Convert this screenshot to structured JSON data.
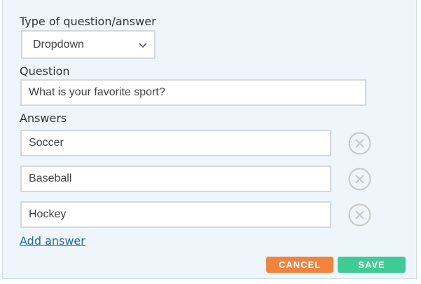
{
  "type_label": "Type of question/answer",
  "type_select": {
    "value": "Dropdown",
    "icon": "chevron-down-icon"
  },
  "question_label": "Question",
  "question_input": {
    "value": "What is your favorite sport?"
  },
  "answers_label": "Answers",
  "answers": [
    {
      "value": "Soccer"
    },
    {
      "value": "Baseball"
    },
    {
      "value": "Hockey"
    }
  ],
  "remove_icon": "close-circle-icon",
  "add_answer_label": "Add answer",
  "buttons": {
    "cancel_label": "CANCEL",
    "save_label": "SAVE"
  },
  "colors": {
    "panel_bg": "#eef6fc",
    "cancel": "#f0843e",
    "save": "#3fcb95",
    "link": "#2a6aa6"
  }
}
